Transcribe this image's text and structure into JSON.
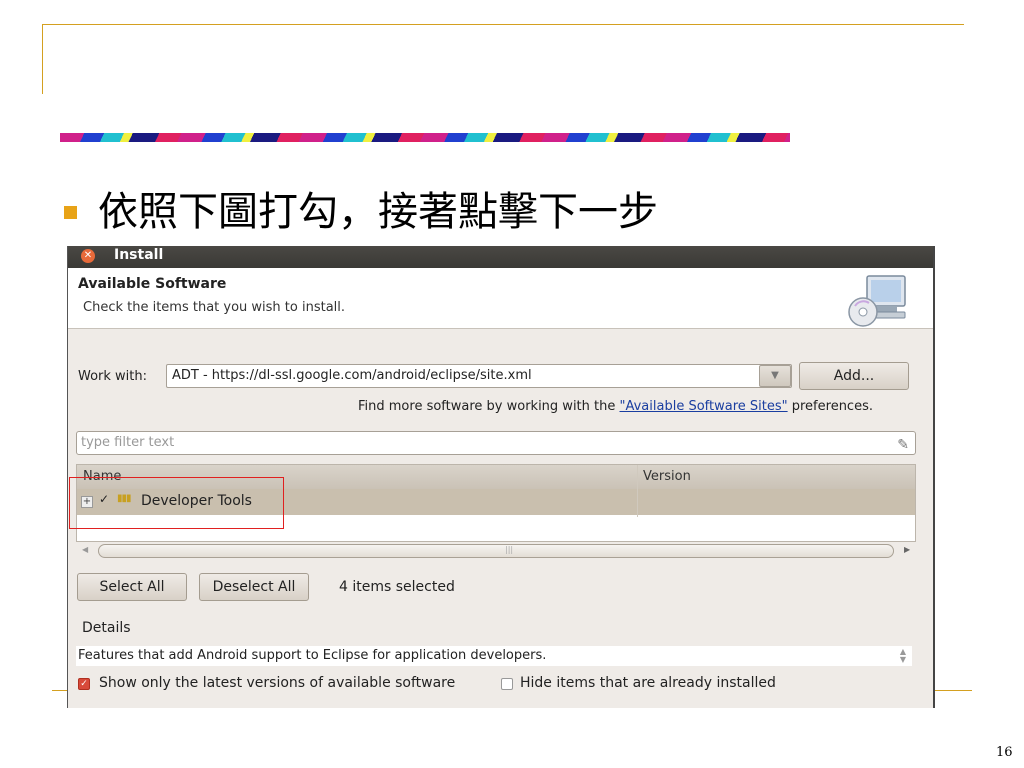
{
  "slide": {
    "heading": "依照下圖打勾，接著點擊下一步",
    "page_number": "16"
  },
  "dialog": {
    "title": "Install",
    "header_title": "Available Software",
    "header_subtitle": "Check the items that you wish to install.",
    "work_with_label": "Work with:",
    "work_with_value": "ADT - https://dl-ssl.google.com/android/eclipse/site.xml",
    "add_button": "Add...",
    "find_more_prefix": "Find more software by working with the",
    "find_more_link": "\"Available Software Sites\"",
    "find_more_suffix": "preferences.",
    "filter_placeholder": "type filter text",
    "table": {
      "columns": [
        "Name",
        "Version"
      ],
      "rows": [
        {
          "name": "Developer Tools",
          "version": "",
          "checked": true
        }
      ]
    },
    "select_all_button": "Select All",
    "deselect_all_button": "Deselect All",
    "selection_status": "4 items selected",
    "details_label": "Details",
    "details_text": "Features that add Android support to Eclipse for application developers.",
    "show_latest_label": "Show only the latest versions of available software",
    "show_latest_checked": true,
    "hide_installed_label": "Hide items that are already installed",
    "hide_installed_checked": false
  },
  "icons": {
    "close": "close-icon",
    "install_header": "install-cd-icon",
    "filter_clear": "clear-filter-icon",
    "expander": "expand-icon",
    "package": "package-icon"
  },
  "colors": {
    "accent": "#e8a317",
    "frame": "#d4a020",
    "highlight_box": "#e02020",
    "link": "#1a3ea0"
  }
}
